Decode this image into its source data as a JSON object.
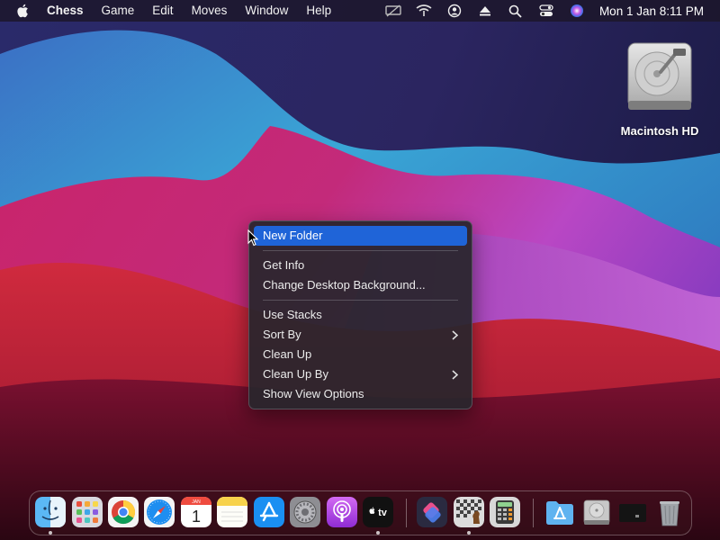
{
  "menubar": {
    "apple_icon": "apple-logo-icon",
    "app_name": "Chess",
    "menus": [
      "Game",
      "Edit",
      "Moves",
      "Window",
      "Help"
    ],
    "status_icons": [
      "screen-mirroring-off-icon",
      "wifi-icon",
      "user-account-icon",
      "eject-icon",
      "spotlight-search-icon",
      "control-center-icon",
      "siri-icon"
    ],
    "clock": "Mon 1 Jan  8:11 PM"
  },
  "desktop": {
    "icons": [
      {
        "label": "Macintosh HD",
        "icon": "hard-drive-icon"
      }
    ]
  },
  "context_menu": {
    "items": [
      {
        "label": "New Folder",
        "highlighted": true,
        "submenu": false
      },
      {
        "label": "Get Info",
        "submenu": false
      },
      {
        "label": "Change Desktop Background...",
        "submenu": false
      },
      {
        "label": "Use Stacks",
        "submenu": false
      },
      {
        "label": "Sort By",
        "submenu": true
      },
      {
        "label": "Clean Up",
        "submenu": false
      },
      {
        "label": "Clean Up By",
        "submenu": true
      },
      {
        "label": "Show View Options",
        "submenu": false
      }
    ]
  },
  "dock": {
    "apps": [
      {
        "name": "Finder",
        "icon": "finder-icon",
        "running": true
      },
      {
        "name": "Launchpad",
        "icon": "launchpad-icon",
        "running": false
      },
      {
        "name": "Google Chrome",
        "icon": "chrome-icon",
        "running": false
      },
      {
        "name": "Safari",
        "icon": "safari-icon",
        "running": false
      },
      {
        "name": "Calendar",
        "icon": "calendar-icon",
        "running": false,
        "month": "JAN",
        "day": "1"
      },
      {
        "name": "Notes",
        "icon": "notes-icon",
        "running": false
      },
      {
        "name": "App Store",
        "icon": "app-store-icon",
        "running": false
      },
      {
        "name": "System Preferences",
        "icon": "system-preferences-icon",
        "running": false
      },
      {
        "name": "Podcasts",
        "icon": "podcasts-icon",
        "running": false
      },
      {
        "name": "TV",
        "icon": "apple-tv-icon",
        "running": true,
        "label": "tv"
      },
      {
        "name": "Shortcuts",
        "icon": "shortcuts-icon",
        "running": false
      },
      {
        "name": "Chess",
        "icon": "chess-icon",
        "running": true
      },
      {
        "name": "Calculator",
        "icon": "calculator-icon",
        "running": false
      },
      {
        "name": "Applications",
        "icon": "applications-folder-icon",
        "running": false
      },
      {
        "name": "Macintosh HD",
        "icon": "hard-drive-icon",
        "running": false
      },
      {
        "name": "Screen",
        "icon": "screen-thumbnail-icon",
        "running": false
      },
      {
        "name": "Trash",
        "icon": "trash-icon",
        "running": false
      }
    ]
  },
  "colors": {
    "menu_highlight": "#1f64d8",
    "menu_background": "#28262c"
  }
}
